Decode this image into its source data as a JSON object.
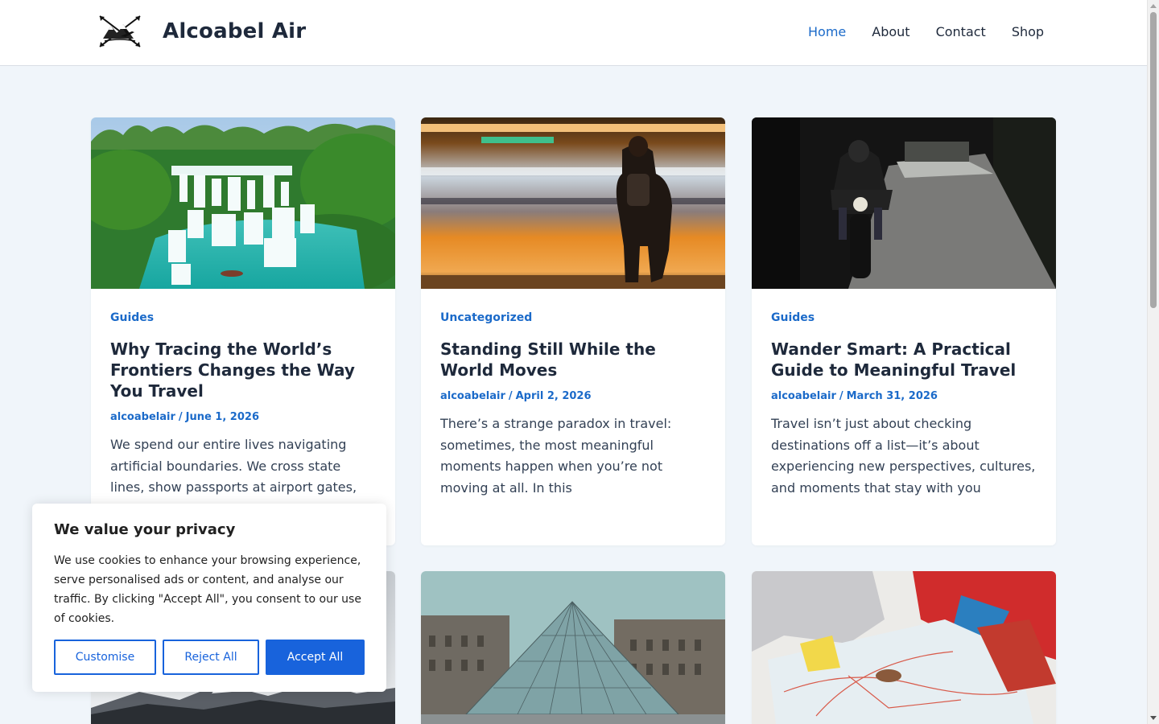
{
  "header": {
    "site_title": "Alcoabel Air",
    "logo_icon": "mountain-airplane-compass-logo",
    "nav": [
      {
        "label": "Home",
        "active": true
      },
      {
        "label": "About",
        "active": false
      },
      {
        "label": "Contact",
        "active": false
      },
      {
        "label": "Shop",
        "active": false
      }
    ]
  },
  "posts": [
    {
      "category": "Guides",
      "title": "Why Tracing the World’s Frontiers Changes the Way You Travel",
      "author": "alcoabelair",
      "separator": "/",
      "date": "June 1, 2026",
      "excerpt": "We spend our entire lives navigating artificial boundaries. We cross state lines, show passports at airport gates,",
      "image": "waterfall-photo"
    },
    {
      "category": "Uncategorized",
      "title": "Standing Still While the World Moves",
      "author": "alcoabelair",
      "separator": "/",
      "date": "April 2, 2026",
      "excerpt": "There’s a strange paradox in travel: sometimes, the most meaningful moments happen when you’re not moving at all. In this",
      "image": "train-platform-photo"
    },
    {
      "category": "Guides",
      "title": "Wander Smart: A Practical Guide to Meaningful Travel",
      "author": "alcoabelair",
      "separator": "/",
      "date": "March 31, 2026",
      "excerpt": "Travel isn’t just about checking destinations off a list—it’s about experiencing new perspectives, cultures, and moments that stay with you",
      "image": "motorcycle-road-photo"
    }
  ],
  "more_post_images": [
    "mountain-photo",
    "louvre-pyramid-photo",
    "map-reading-photo"
  ],
  "cookie_banner": {
    "title": "We value your privacy",
    "text": "We use cookies to enhance your browsing experience, serve personalised ads or content, and analyse our traffic. By clicking \"Accept All\", you consent to our use of cookies.",
    "buttons": {
      "customise": "Customise",
      "reject": "Reject All",
      "accept": "Accept All"
    }
  },
  "colors": {
    "accent": "#1b6ac9",
    "page_bg": "#f0f5fa",
    "button_primary": "#1863dc"
  }
}
